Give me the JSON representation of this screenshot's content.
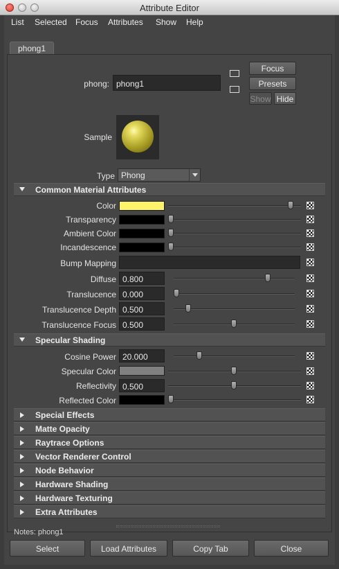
{
  "window": {
    "title": "Attribute Editor"
  },
  "menu": [
    "List",
    "Selected",
    "Focus",
    "Attributes",
    "Show",
    "Help"
  ],
  "tab": "phong1",
  "node": {
    "label": "phong:",
    "value": "phong1"
  },
  "buttons": {
    "focus": "Focus",
    "presets": "Presets",
    "show": "Show",
    "hide": "Hide"
  },
  "sample_label": "Sample",
  "type": {
    "label": "Type",
    "value": "Phong"
  },
  "common": {
    "title": "Common Material Attributes",
    "color": {
      "label": "Color",
      "swatch": "#fff36b",
      "level": 0.95
    },
    "transparency": {
      "label": "Transparency",
      "swatch": "#000000",
      "level": 0.0
    },
    "ambient": {
      "label": "Ambient Color",
      "swatch": "#000000",
      "level": 0.0
    },
    "incandescence": {
      "label": "Incandescence",
      "swatch": "#000000",
      "level": 0.0
    },
    "bump": {
      "label": "Bump Mapping"
    },
    "diffuse": {
      "label": "Diffuse",
      "value": "0.800",
      "level": 0.8
    },
    "translucence": {
      "label": "Translucence",
      "value": "0.000",
      "level": 0.0
    },
    "trans_depth": {
      "label": "Translucence Depth",
      "value": "0.500",
      "level": 0.1
    },
    "trans_focus": {
      "label": "Translucence Focus",
      "value": "0.500",
      "level": 0.5
    }
  },
  "specular": {
    "title": "Specular Shading",
    "cosine": {
      "label": "Cosine Power",
      "value": "20.000",
      "level": 0.2
    },
    "spec_color": {
      "label": "Specular Color",
      "swatch": "#808080",
      "level": 0.5
    },
    "reflectivity": {
      "label": "Reflectivity",
      "value": "0.500",
      "level": 0.5
    },
    "reflected": {
      "label": "Reflected Color",
      "swatch": "#000000",
      "level": 0.0
    }
  },
  "collapsed": [
    "Special Effects",
    "Matte Opacity",
    "Raytrace Options",
    "Vector Renderer Control",
    "Node Behavior",
    "Hardware Shading",
    "Hardware Texturing",
    "Extra Attributes"
  ],
  "notes": "Notes:  phong1",
  "footer": [
    "Select",
    "Load Attributes",
    "Copy Tab",
    "Close"
  ]
}
